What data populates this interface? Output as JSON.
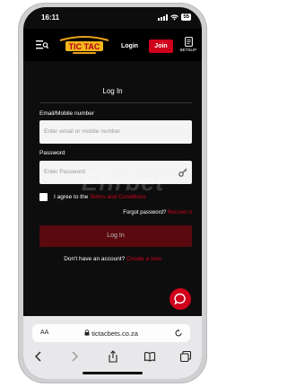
{
  "status_bar": {
    "time": "16:11",
    "battery": "55"
  },
  "header": {
    "logo_text": "TIC TAC",
    "login_label": "Login",
    "join_label": "Join",
    "betslip_label": "BETSLIP"
  },
  "login_form": {
    "title": "Log In",
    "email_label": "Email/Mobile number",
    "email_placeholder": "Enter email or mobile number",
    "password_label": "Password",
    "password_placeholder": "Enter Password",
    "agree_prefix": "I agree to the",
    "terms_link": "Terms and Conditions",
    "forgot_text": "Forgot password?",
    "recover_link": "Recover it",
    "submit_label": "Log In",
    "no_account_text": "Don't have an account?",
    "create_link": "Create a new"
  },
  "watermark": "Efirbet",
  "browser": {
    "aa_label": "AA",
    "url": "tictacbets.co.za"
  },
  "colors": {
    "brand_red": "#d0021b",
    "background": "#0d0d0d"
  }
}
